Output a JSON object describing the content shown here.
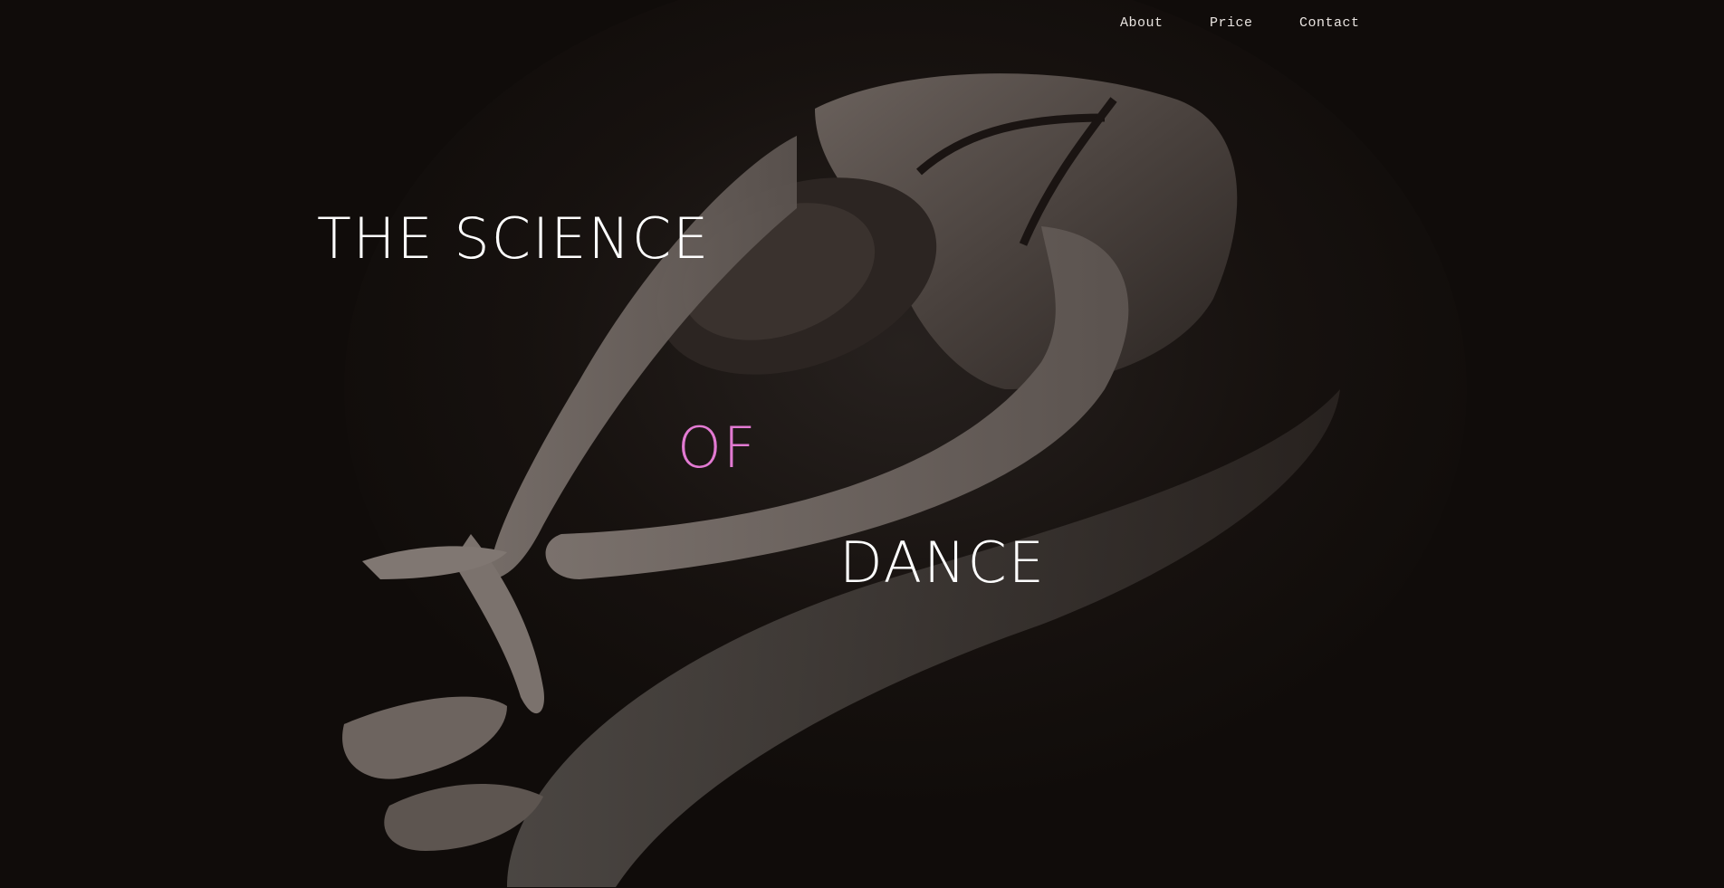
{
  "nav": {
    "items": [
      {
        "label": "About"
      },
      {
        "label": "Price"
      },
      {
        "label": "Contact"
      }
    ]
  },
  "hero": {
    "line1": "THE SCIENCE",
    "line2": "OF",
    "line3": "DANCE",
    "accent_color": "#e27ad2",
    "background_color": "#100c0a",
    "image": "dancer-stretching-photo"
  }
}
